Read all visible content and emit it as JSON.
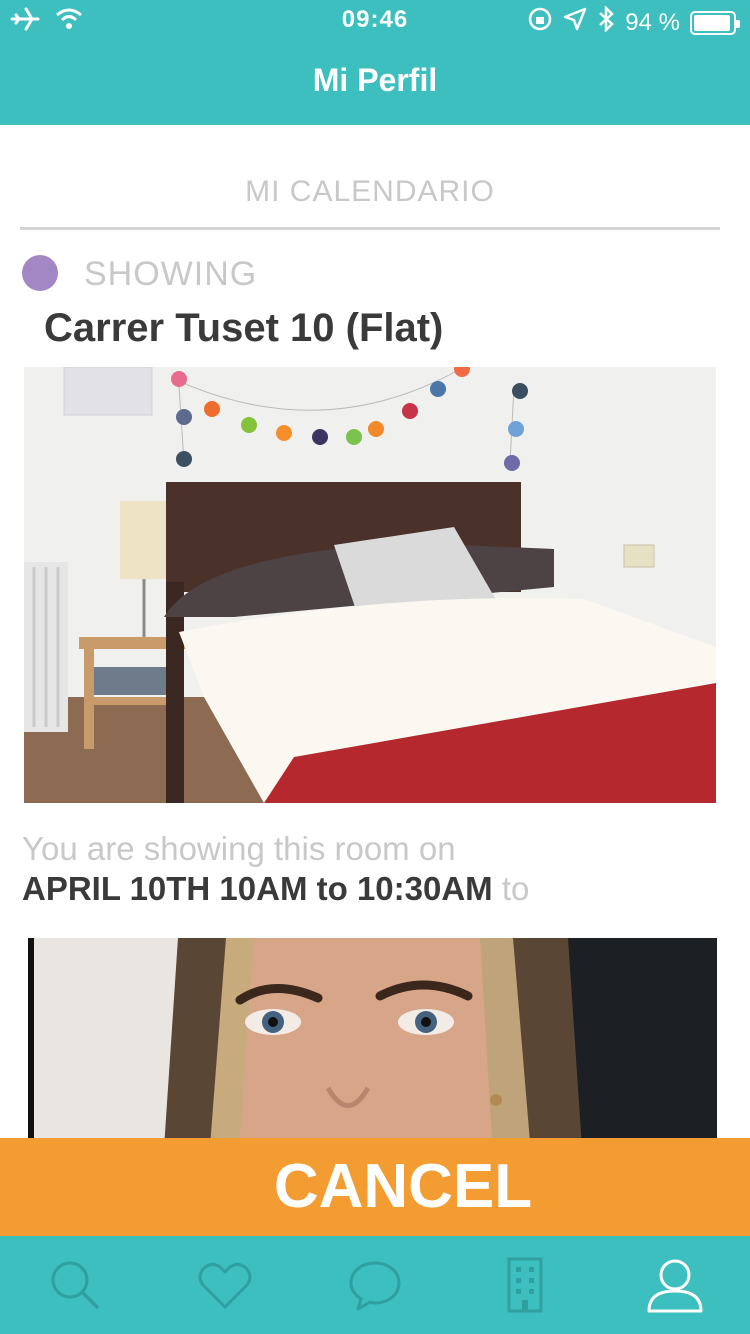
{
  "status_bar": {
    "time": "09:46",
    "battery": "94 %",
    "battery_level": 0.94
  },
  "header": {
    "title": "Mi Perfil"
  },
  "calendar": {
    "section_title": "MI CALENDARIO",
    "event": {
      "type_label": "SHOWING",
      "dot_color": "#a386c4",
      "place": "Carrer Tuset 10 (Flat)",
      "sentence": "You are showing this room on",
      "datetime": "APRIL 10TH 10AM to 10:30AM",
      "suffix": "to"
    }
  },
  "actions": {
    "cancel_label": "CANCEL"
  },
  "tabbar": {
    "active_index": 4,
    "tabs": [
      {
        "icon": "search-icon"
      },
      {
        "icon": "heart-icon"
      },
      {
        "icon": "chat-icon"
      },
      {
        "icon": "building-icon"
      },
      {
        "icon": "profile-icon"
      }
    ]
  },
  "colors": {
    "primary": "#3cbfbe",
    "accent": "#f39c32",
    "muted_text": "#c8c8c8",
    "inactive_tab_icon": "#2f9f9f"
  }
}
